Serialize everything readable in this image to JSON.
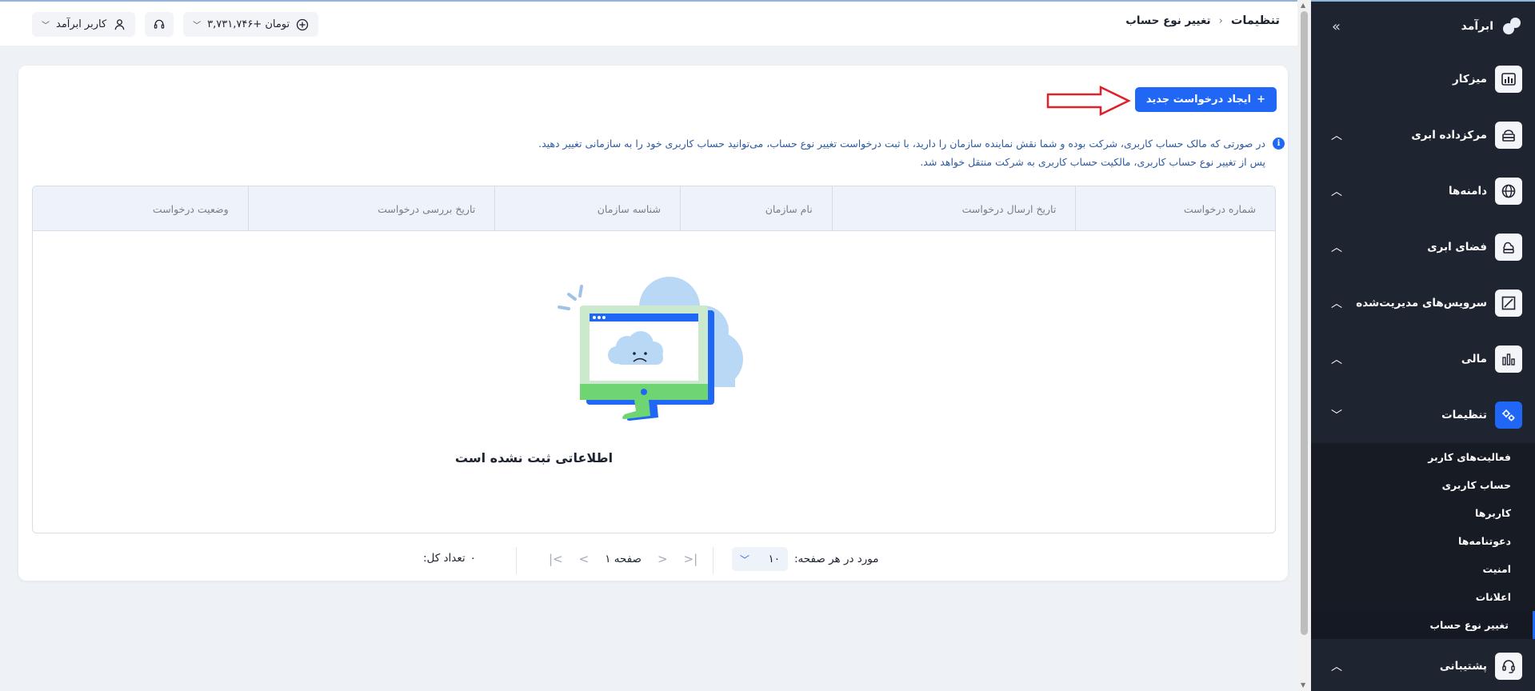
{
  "sidebar": {
    "brand": "ابرآمد",
    "items": [
      {
        "label": "میزکار",
        "icon": "dashboard-icon",
        "chevron": ""
      },
      {
        "label": "مرکزداده ابری",
        "icon": "datacenter-icon",
        "chevron": "︿"
      },
      {
        "label": "دامنه‌ها",
        "icon": "globe-icon",
        "chevron": "︿"
      },
      {
        "label": "فضای ابری",
        "icon": "cloud-storage-icon",
        "chevron": "︿"
      },
      {
        "label": "سرویس‌های مدیریت‌شده",
        "icon": "managed-services-icon",
        "chevron": "︿"
      },
      {
        "label": "مالی",
        "icon": "finance-icon",
        "chevron": "︿"
      },
      {
        "label": "تنظیمات",
        "icon": "settings-icon",
        "chevron": "﹀"
      }
    ],
    "settings_sub": [
      "فعالیت‌های کاربر",
      "حساب کاربری",
      "کاربرها",
      "دعوتنامه‌ها",
      "امنیت",
      "اعلانات",
      "تغییر نوع حساب"
    ],
    "support": {
      "label": "پشتیبانی",
      "chevron": "︿"
    }
  },
  "topbar": {
    "breadcrumb_root": "تنظیمات",
    "breadcrumb_sep": "›",
    "breadcrumb_current": "تغییر نوع حساب",
    "user_label": "کاربر ابرآمد",
    "balance": "۳,۷۳۱,۷۴۶+ تومان"
  },
  "main": {
    "new_request_label": "ایجاد درخواست جدید",
    "info_line_1": "در صورتی که مالک حساب کاربری، شرکت بوده و شما نقش نماینده سازمان را دارید، با ثبت درخواست تغییر نوع حساب، می‌توانید حساب کاربری خود را به سازمانی تغییر دهید.",
    "info_line_2": "پس از تغییر نوع حساب کاربری، مالکیت حساب کاربری به شرکت منتقل خواهد شد.",
    "table_headers": [
      "شماره درخواست",
      "تاریخ ارسال درخواست",
      "نام سازمان",
      "شناسه سازمان",
      "تاریخ بررسی درخواست",
      "وضعیت درخواست"
    ],
    "empty_text": "اطلاعاتی ثبت نشده است"
  },
  "pagination": {
    "per_page_label": "مورد در هر صفحه:",
    "per_page_value": "۱۰",
    "page_label": "صفحه ۱",
    "total_label": "تعداد کل:",
    "total_value": "۰"
  },
  "colors": {
    "accent": "#1f67f4",
    "sidebar_bg": "#1e2430",
    "annotation_arrow": "#e0202a"
  }
}
